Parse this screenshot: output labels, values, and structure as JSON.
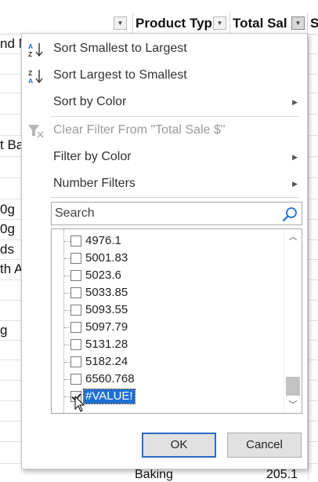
{
  "sheet": {
    "headers": [
      {
        "label": "",
        "filtered": false
      },
      {
        "label": "Product Typ",
        "filtered": false
      },
      {
        "label": "Total Sal",
        "filtered": true
      },
      {
        "label": "S",
        "filtered": false
      }
    ],
    "left_cells": [
      {
        "text": "nd N"
      },
      {
        "text": "t Ba"
      },
      {
        "text": "0g"
      },
      {
        "text": "0g"
      },
      {
        "text": "ds"
      },
      {
        "text": "th A"
      },
      {
        "text": "g"
      }
    ],
    "bottom_row": {
      "category": "Baking",
      "value": "205.1"
    }
  },
  "filter_menu": {
    "sort_asc": {
      "label": "Sort Smallest to Largest",
      "icon": "sort-ascending-icon"
    },
    "sort_desc": {
      "label": "Sort Largest to Smallest",
      "icon": "sort-descending-icon"
    },
    "sort_by_color": {
      "label": "Sort by Color"
    },
    "clear_filter": {
      "label": "Clear Filter From \"Total Sale $\"",
      "icon": "clear-filter-icon"
    },
    "filter_by_color": {
      "label": "Filter by Color"
    },
    "number_filters": {
      "label": "Number Filters"
    },
    "search": {
      "placeholder": "Search",
      "value": "",
      "icon": "search-icon"
    },
    "values": [
      {
        "label": "4976.1",
        "checked": false
      },
      {
        "label": "5001.83",
        "checked": false
      },
      {
        "label": "5023.6",
        "checked": false
      },
      {
        "label": "5033.85",
        "checked": false
      },
      {
        "label": "5093.55",
        "checked": false
      },
      {
        "label": "5097.79",
        "checked": false
      },
      {
        "label": "5131.28",
        "checked": false
      },
      {
        "label": "5182.24",
        "checked": false
      },
      {
        "label": "6560.768",
        "checked": false
      },
      {
        "label": "#VALUE!",
        "checked": true,
        "selected": true
      }
    ],
    "scrollbar_position": 0.92,
    "ok_label": "OK",
    "cancel_label": "Cancel"
  },
  "colors": {
    "selection": "#1e6fd1",
    "ok_border": "#2a6cc8",
    "disabled_text": "#9a9a9a"
  }
}
